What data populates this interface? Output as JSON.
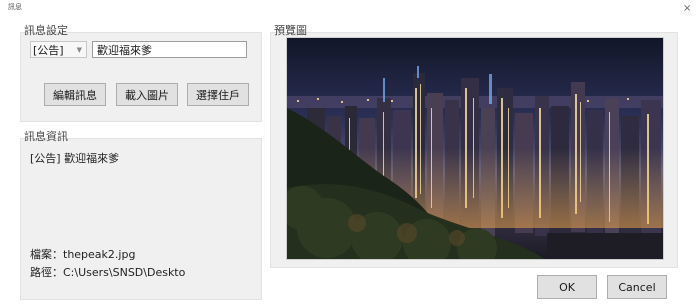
{
  "window": {
    "title": "訊息",
    "close_glyph": "×"
  },
  "settings": {
    "group_title": "訊息設定",
    "category_value": "[公告]",
    "message_value": "歡迎福來爹",
    "buttons": {
      "edit": "編輯訊息",
      "load_image": "載入圖片",
      "select_resident": "選擇住戶"
    }
  },
  "info": {
    "group_title": "訊息資訊",
    "message_text": "[公告] 歡迎福來爹",
    "file_label": "檔案：thepeak2.jpg",
    "path_label": "路徑：C:\\Users\\SNSD\\Deskto"
  },
  "preview": {
    "group_title": "預覽圖"
  },
  "footer": {
    "ok_label": "OK",
    "cancel_label": "Cancel"
  },
  "icons": {
    "combo_arrow": "chevron-down-icon",
    "close": "close-icon"
  }
}
